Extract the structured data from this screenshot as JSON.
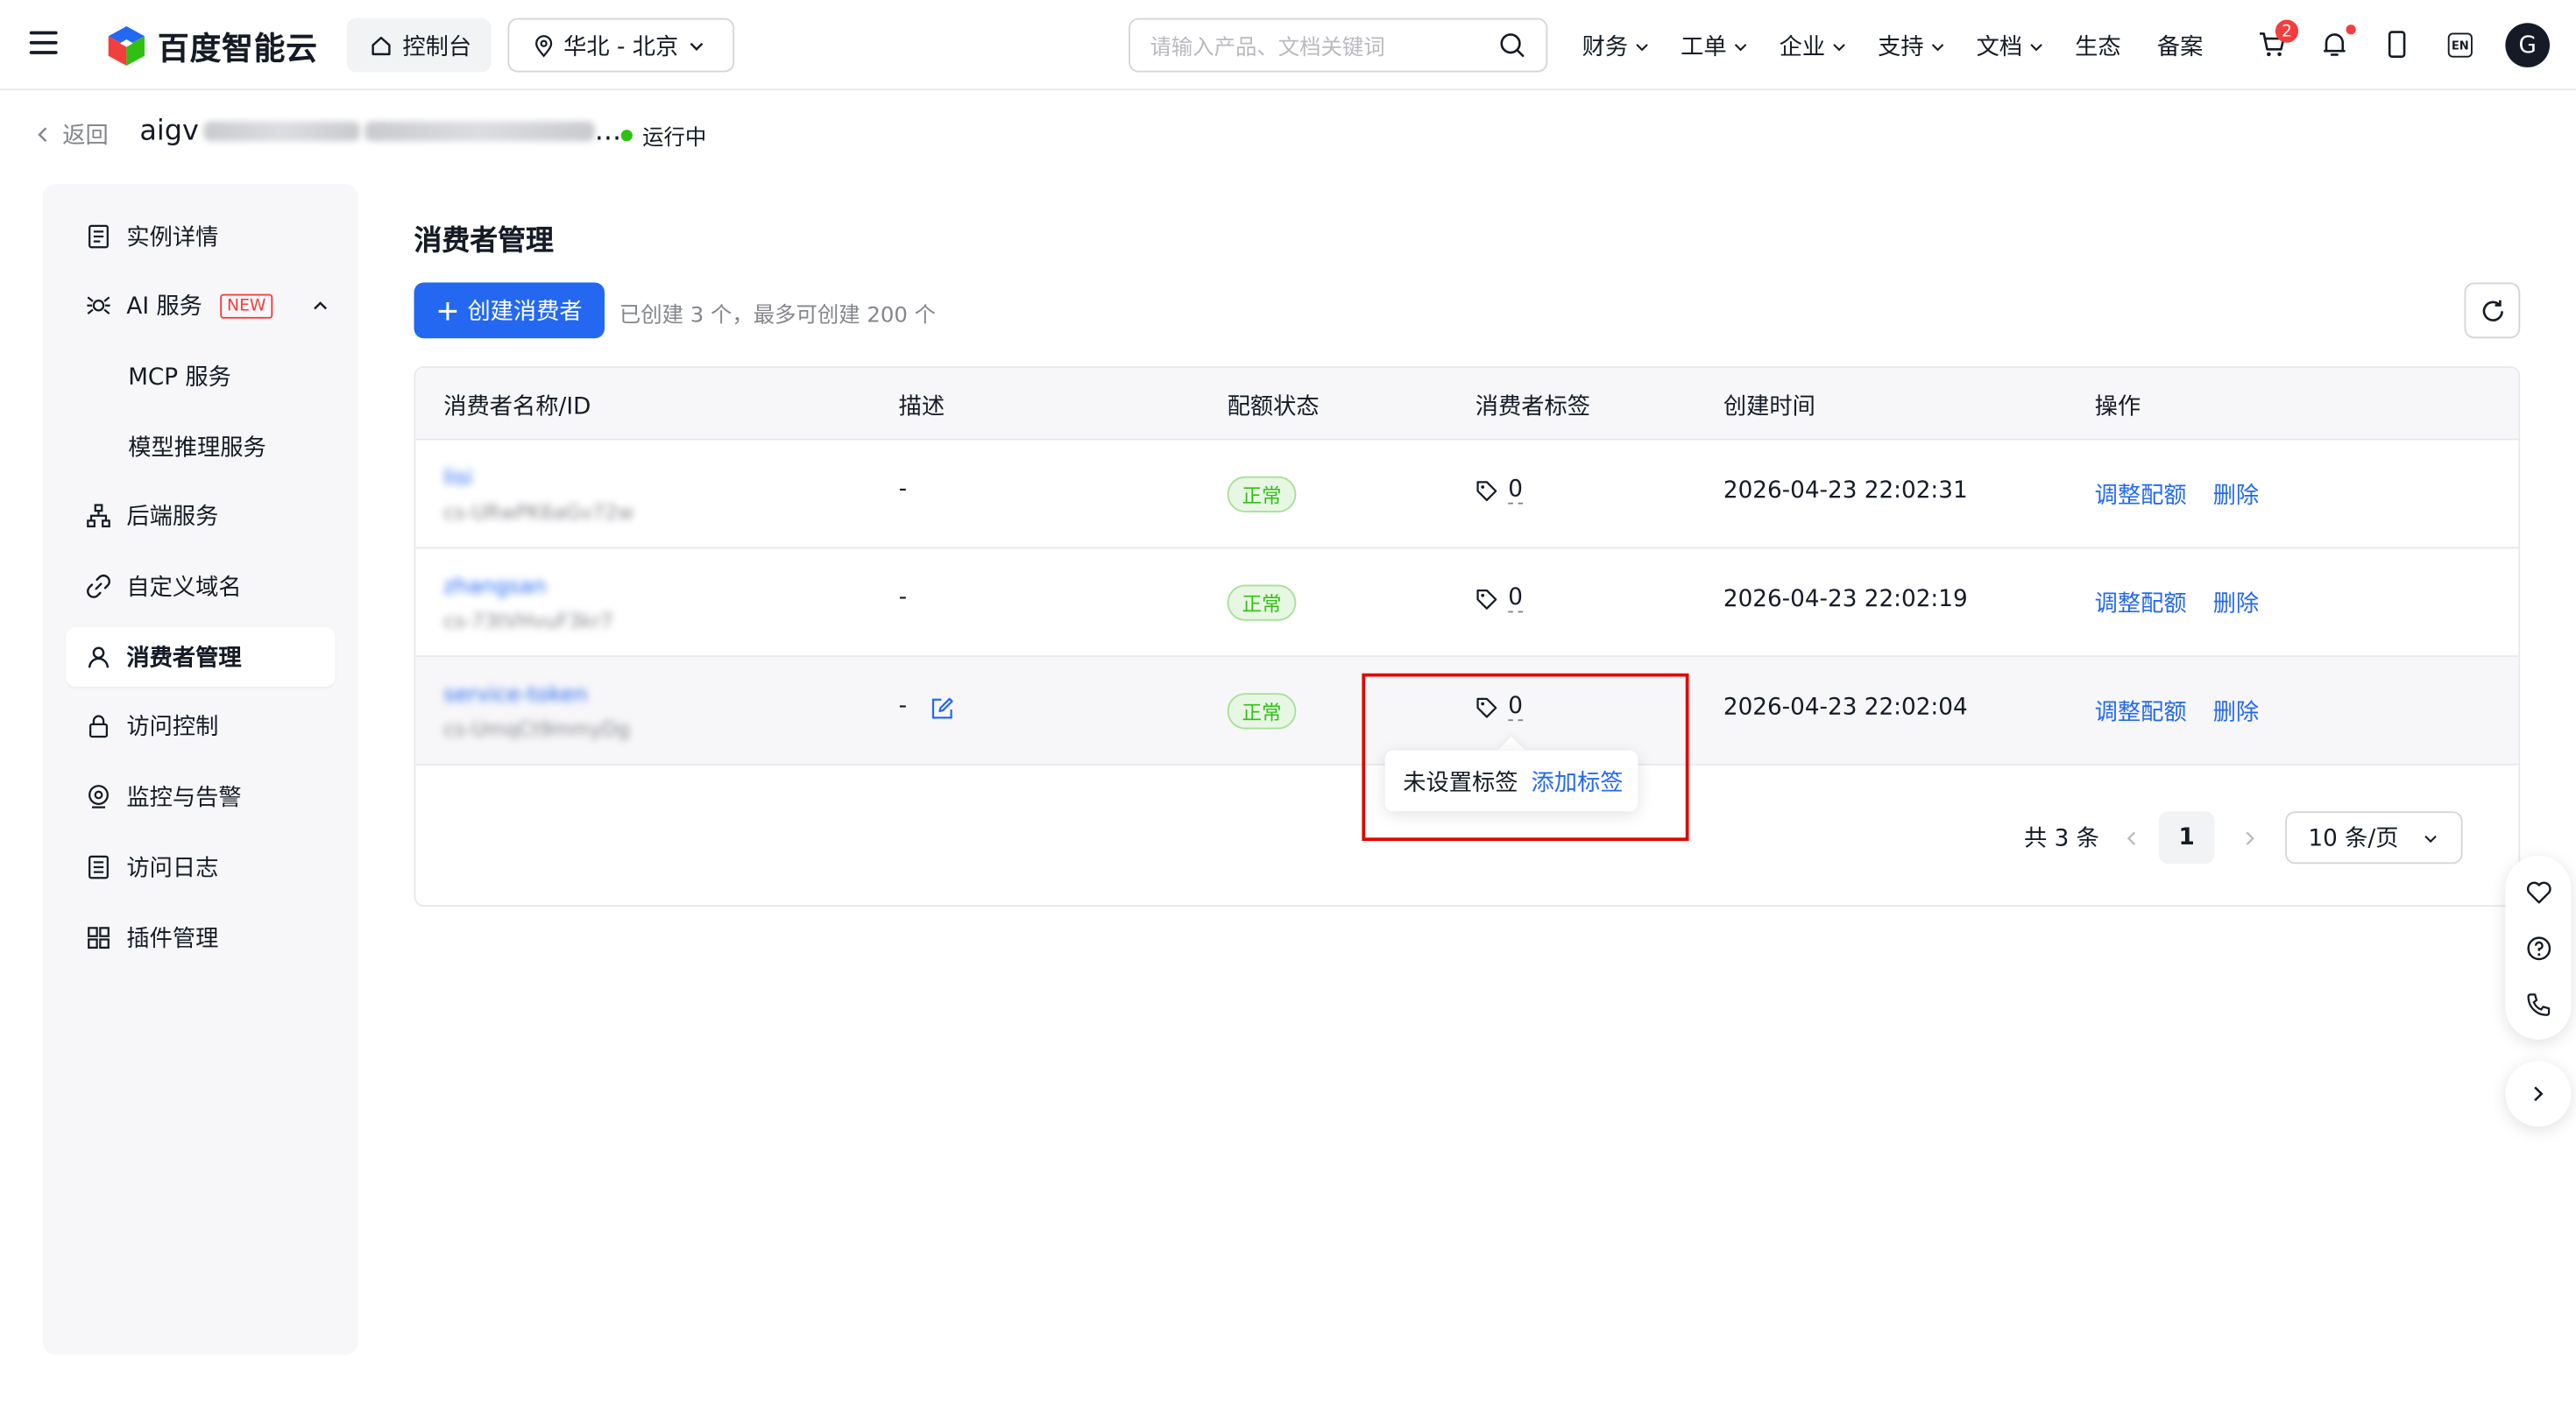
{
  "topbar": {
    "brand": "百度智能云",
    "console": "控制台",
    "region": "华北 - 北京",
    "search_placeholder": "请输入产品、文档关键词",
    "nav": [
      {
        "label": "财务",
        "has_dropdown": true
      },
      {
        "label": "工单",
        "has_dropdown": true
      },
      {
        "label": "企业",
        "has_dropdown": true
      },
      {
        "label": "支持",
        "has_dropdown": true
      },
      {
        "label": "文档",
        "has_dropdown": true
      },
      {
        "label": "生态",
        "has_dropdown": false
      },
      {
        "label": "备案",
        "has_dropdown": false
      }
    ],
    "cart_badge": "2",
    "lang": "EN",
    "avatar_letter": "G"
  },
  "header": {
    "back": "返回",
    "instance_name_visible": "aigv",
    "instance_name_suffix": "...",
    "status": "运行中",
    "status_color": "#30bf13"
  },
  "sidebar": {
    "items": [
      {
        "label": "实例详情",
        "icon": "list-icon"
      },
      {
        "label": "AI 服务",
        "icon": "ai-icon",
        "badge": "NEW",
        "expanded": true
      },
      {
        "label": "MCP 服务",
        "sub": true
      },
      {
        "label": "模型推理服务",
        "sub": true
      },
      {
        "label": "后端服务",
        "icon": "hierarchy-icon"
      },
      {
        "label": "自定义域名",
        "icon": "link-icon"
      },
      {
        "label": "消费者管理",
        "icon": "user-icon",
        "active": true
      },
      {
        "label": "访问控制",
        "icon": "lock-icon"
      },
      {
        "label": "监控与告警",
        "icon": "monitor-icon"
      },
      {
        "label": "访问日志",
        "icon": "log-icon"
      },
      {
        "label": "插件管理",
        "icon": "grid-icon"
      }
    ]
  },
  "main": {
    "title": "消费者管理",
    "create_button": "创建消费者",
    "create_hint": "已创建 3 个，最多可创建 200 个",
    "table": {
      "columns": [
        "消费者名称/ID",
        "描述",
        "配额状态",
        "消费者标签",
        "创建时间",
        "操作"
      ],
      "rows": [
        {
          "name": "lisi",
          "id": "cs-URwPK6aGv72w",
          "desc": "-",
          "status": "正常",
          "tags": "0",
          "created": "2026-04-23 22:02:31",
          "ops": [
            "调整配额",
            "删除"
          ]
        },
        {
          "name": "zhangsan",
          "id": "cs-73tVHvuF3kr7",
          "desc": "-",
          "status": "正常",
          "tags": "0",
          "created": "2026-04-23 22:02:19",
          "ops": [
            "调整配额",
            "删除"
          ]
        },
        {
          "name": "service-token",
          "id": "cs-UmqCt9mmyDg",
          "desc": "-",
          "status": "正常",
          "tags": "0",
          "created": "2026-04-23 22:02:04",
          "ops": [
            "调整配额",
            "删除"
          ]
        }
      ]
    },
    "tooltip": {
      "text": "未设置标签",
      "link": "添加标签"
    },
    "pagination": {
      "total": "共 3 条",
      "current_page": "1",
      "page_size": "10 条/页"
    }
  },
  "colors": {
    "primary": "#2468f2",
    "success": "#30bf13",
    "danger": "#f33e3e",
    "highlight": "#e10600"
  }
}
